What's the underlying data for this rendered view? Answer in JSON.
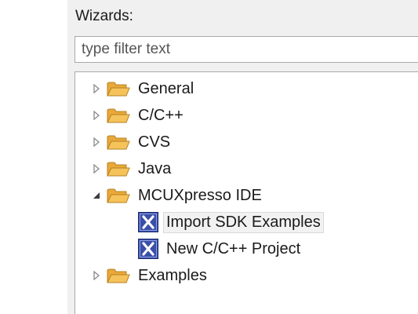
{
  "wizards": {
    "label": "Wizards:",
    "filter_placeholder": "type filter text"
  },
  "tree": {
    "items": [
      {
        "label": "General",
        "icon": "folder-icon",
        "expanded": false
      },
      {
        "label": "C/C++",
        "icon": "folder-icon",
        "expanded": false
      },
      {
        "label": "CVS",
        "icon": "folder-icon",
        "expanded": false
      },
      {
        "label": "Java",
        "icon": "folder-icon",
        "expanded": false
      },
      {
        "label": "MCUXpresso IDE",
        "icon": "folder-icon",
        "expanded": true,
        "children": [
          {
            "label": "Import SDK Examples",
            "icon": "mcuxpresso-wizard-icon",
            "selected": true
          },
          {
            "label": "New C/C++ Project",
            "icon": "mcuxpresso-wizard-icon",
            "selected": false
          }
        ]
      },
      {
        "label": "Examples",
        "icon": "folder-icon",
        "expanded": false
      }
    ]
  },
  "colors": {
    "folder": "#f5c35a",
    "wizard_icon_bg": "#3a4fa8",
    "selection": "#f2f2f2"
  }
}
